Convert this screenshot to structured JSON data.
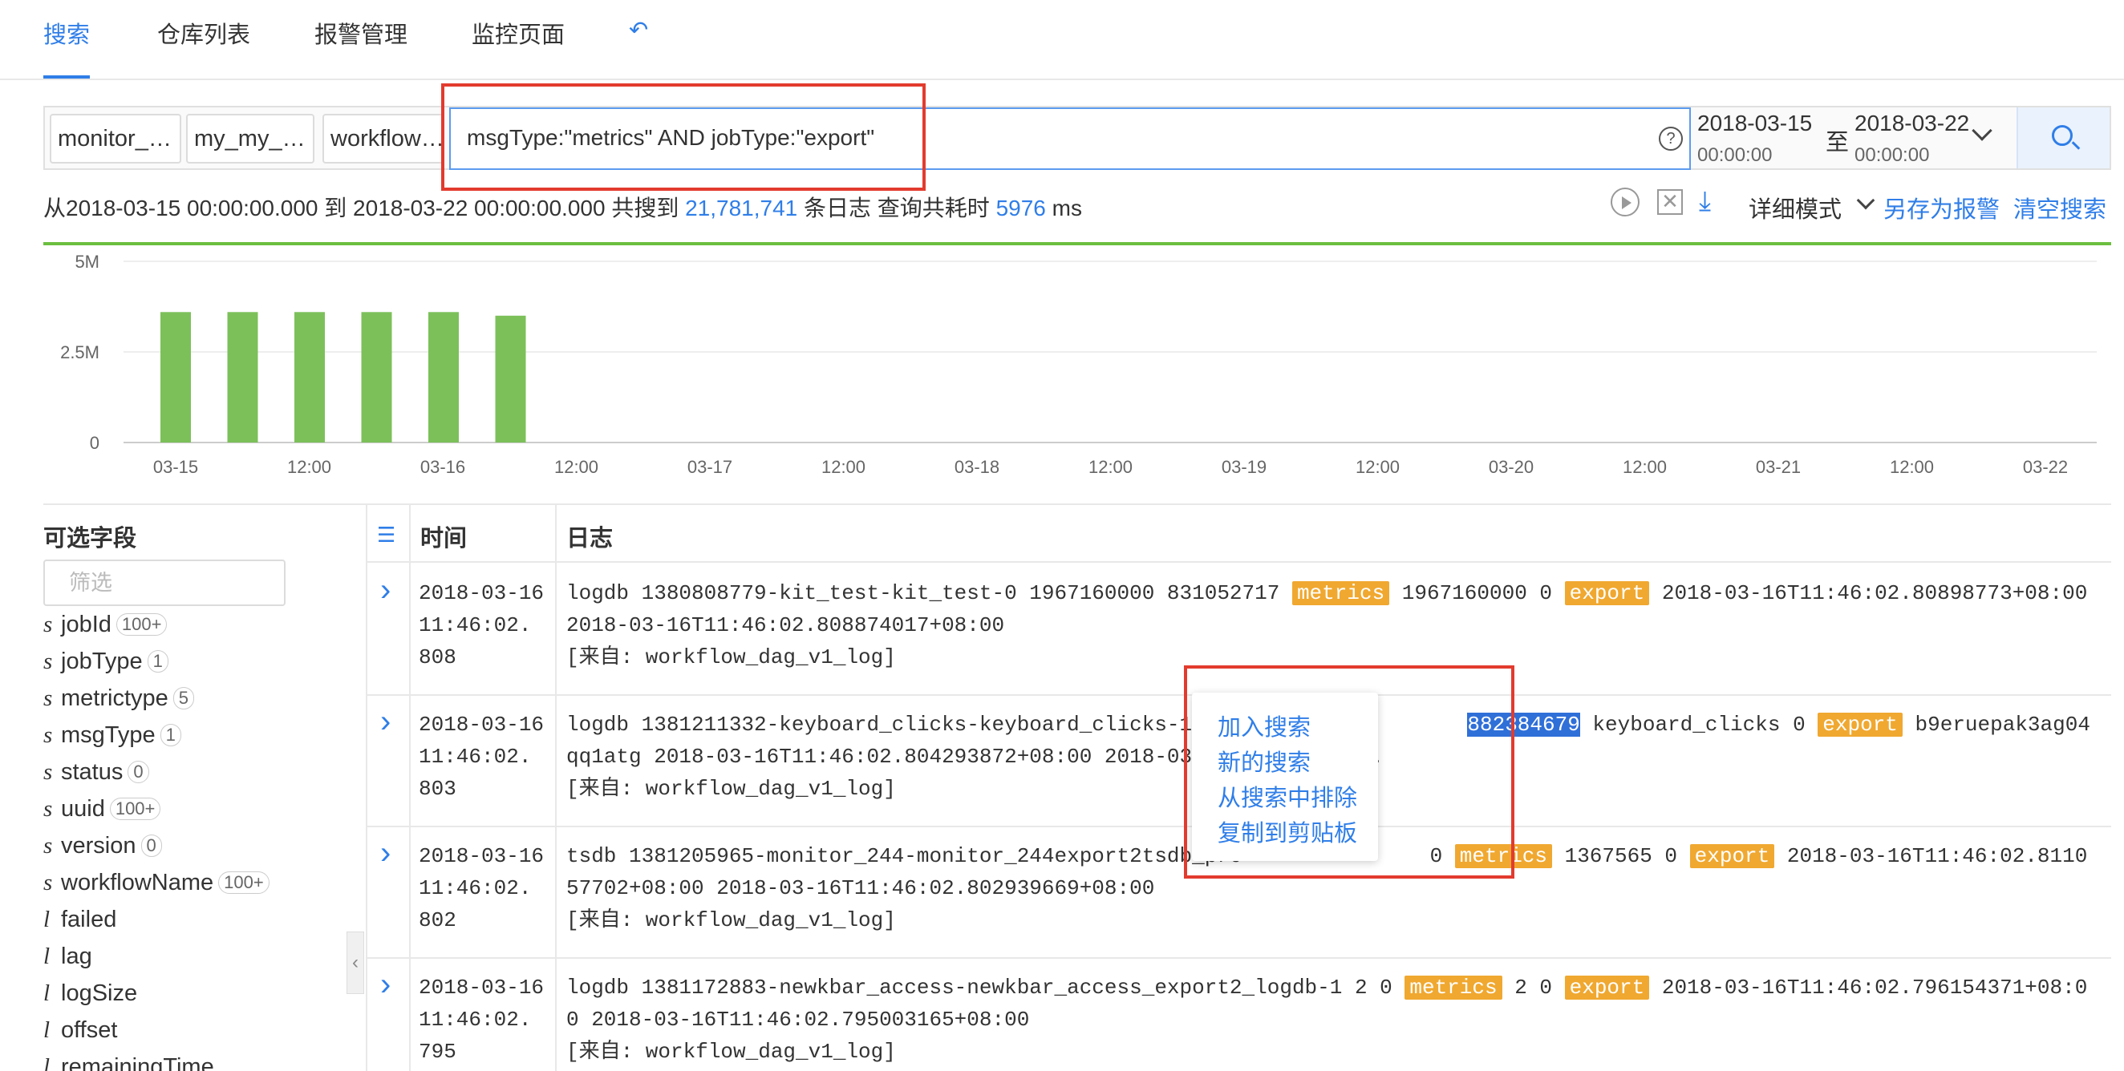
{
  "nav": {
    "tabs": [
      "搜索",
      "仓库列表",
      "报警管理",
      "监控页面"
    ],
    "back_icon": "↶"
  },
  "search": {
    "repos": [
      "monitor_…",
      "my_my_…",
      "workflow…"
    ],
    "query": "msgType:\"metrics\" AND jobType:\"export\"",
    "help_icon": "?",
    "from_date": "2018-03-15",
    "from_time": "00:00:00",
    "to_label": "至",
    "to_date": "2018-03-22",
    "to_time": "00:00:00"
  },
  "summary": {
    "prefix": "从2018-03-15 00:00:00.000 到 2018-03-22 00:00:00.000 共搜到 ",
    "count": "21,781,741",
    "middle": " 条日志 查询共耗时 ",
    "ms": "5976",
    "suffix": " ms"
  },
  "toolbar": {
    "close_icon": "✕",
    "download_icon": "⤓",
    "mode_label": "详细模式",
    "save_alert": "另存为报警",
    "clear_search": "清空搜索"
  },
  "chart_data": {
    "type": "bar",
    "yticks": [
      "5M",
      "2.5M",
      "0"
    ],
    "xticks": [
      "03-15",
      "12:00",
      "03-16",
      "12:00",
      "03-17",
      "12:00",
      "03-18",
      "12:00",
      "03-19",
      "12:00",
      "03-20",
      "12:00",
      "03-21",
      "12:00",
      "03-22"
    ],
    "ylim": [
      0,
      5000000
    ],
    "values": [
      3600000,
      3600000,
      3600000,
      3600000,
      3600000,
      3500000
    ],
    "bar_color": "#7cc05a",
    "grid": true
  },
  "sidebar": {
    "title": "可选字段",
    "filter_placeholder": "筛选",
    "fields": [
      {
        "type": "s",
        "name": "jobId",
        "count": "100+"
      },
      {
        "type": "s",
        "name": "jobType",
        "count": "1"
      },
      {
        "type": "s",
        "name": "metrictype",
        "count": "5"
      },
      {
        "type": "s",
        "name": "msgType",
        "count": "1"
      },
      {
        "type": "s",
        "name": "status",
        "count": "0"
      },
      {
        "type": "s",
        "name": "uuid",
        "count": "100+"
      },
      {
        "type": "s",
        "name": "version",
        "count": "0"
      },
      {
        "type": "s",
        "name": "workflowName",
        "count": "100+"
      },
      {
        "type": "l",
        "name": "failed",
        "count": ""
      },
      {
        "type": "l",
        "name": "lag",
        "count": ""
      },
      {
        "type": "l",
        "name": "logSize",
        "count": ""
      },
      {
        "type": "l",
        "name": "offset",
        "count": ""
      },
      {
        "type": "l",
        "name": "remainingTime",
        "count": ""
      }
    ],
    "collapse_icon": "‹"
  },
  "table": {
    "col_icon": "☰",
    "col_time": "时间",
    "col_log": "日志",
    "rows": [
      {
        "time": "2018-03-16 11:46:02. 808",
        "segments": [
          {
            "t": "logdb 1380808779-kit_test-kit_test-0 1967160000 831052717 "
          },
          {
            "t": "metrics",
            "c": "tag"
          },
          {
            "t": " 1967160000 0 "
          },
          {
            "t": "export",
            "c": "tag"
          },
          {
            "t": " 2018-03-16T11:46:02.80898773+08:00 2018-03-16T11:46:02.808874017+08:00\n[来自: workflow_dag_v1_log]"
          }
        ]
      },
      {
        "time": "2018-03-16 11:46:02. 803",
        "segments": [
          {
            "t": "logdb 1381211332-keyboard_clicks-keyboard_clicks-1 882…                 "
          },
          {
            "t": "882384679",
            "c": "hl"
          },
          {
            "t": " keyboard_clicks 0 "
          },
          {
            "t": "export",
            "c": "tag"
          },
          {
            "t": " b9eruepak3ag04qq1atg 2018-03-16T11:46:02.804293872+08:00 2018-03-16T11:46:02.8…\n[来自: workflow_dag_v1_log]"
          }
        ]
      },
      {
        "time": "2018-03-16 11:46:02. 802",
        "segments": [
          {
            "t": "tsdb 1381205965-monitor_244-monitor_244export2tsdb_pro               0 "
          },
          {
            "t": "metrics",
            "c": "tag"
          },
          {
            "t": " 1367565 0 "
          },
          {
            "t": "export",
            "c": "tag"
          },
          {
            "t": " 2018-03-16T11:46:02.811057702+08:00 2018-03-16T11:46:02.802939669+08:00\n[来自: workflow_dag_v1_log]"
          }
        ]
      },
      {
        "time": "2018-03-16 11:46:02. 795",
        "segments": [
          {
            "t": "logdb 1381172883-newkbar_access-newkbar_access_export2_logdb-1 2 0 "
          },
          {
            "t": "metrics",
            "c": "tag"
          },
          {
            "t": " 2 0 "
          },
          {
            "t": "export",
            "c": "tag"
          },
          {
            "t": " 2018-03-16T11:46:02.796154371+08:00 2018-03-16T11:46:02.795003165+08:00\n[来自: workflow_dag_v1_log]"
          }
        ]
      }
    ]
  },
  "context_menu": {
    "items": [
      "加入搜索",
      "新的搜索",
      "从搜索中排除",
      "复制到剪贴板"
    ]
  }
}
